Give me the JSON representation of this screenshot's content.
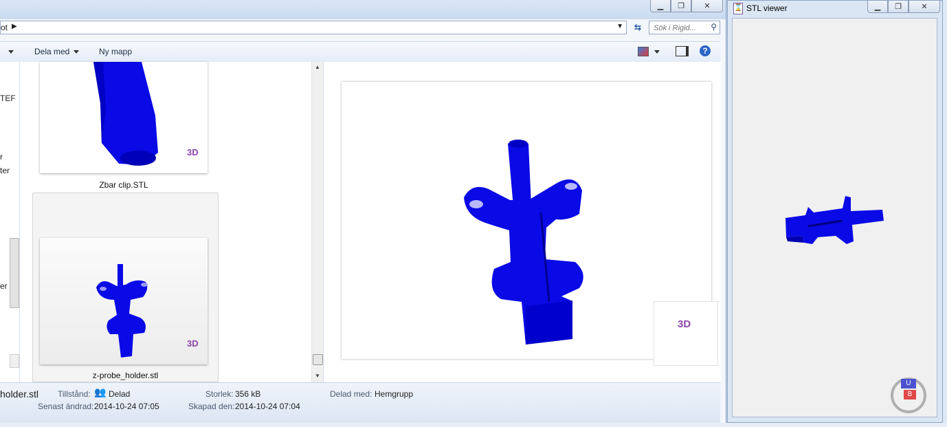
{
  "explorer": {
    "address_fragment": "ot",
    "search_placeholder": "Sök i Rigid...",
    "toolbar": {
      "share_label": "Dela med",
      "new_folder_label": "Ny mapp"
    },
    "nav_fragments": [
      "TEF",
      "r",
      "ter",
      "er"
    ],
    "files": [
      {
        "name": "Zbar clip.STL",
        "selected": false
      },
      {
        "name": "z-probe_holder.stl",
        "selected": true
      }
    ],
    "thumb_logo": "3D",
    "details": {
      "file_name_fragment": "holder.stl",
      "status_label": "Tillstånd:",
      "status_value": "Delad",
      "size_label": "Storlek:",
      "size_value": "356 kB",
      "shared_label": "Delad med:",
      "shared_value": "Hemgrupp",
      "modified_label": "Senast ändrad:",
      "modified_value": "2014-10-24 07:05",
      "created_label": "Skapad den:",
      "created_value": "2014-10-24 07:04"
    }
  },
  "viewer": {
    "title": "STL viewer",
    "cube_faces": [
      "U",
      "B"
    ]
  },
  "colors": {
    "model_blue": "#0a0ae6",
    "logo_purple": "#8e44ad"
  }
}
